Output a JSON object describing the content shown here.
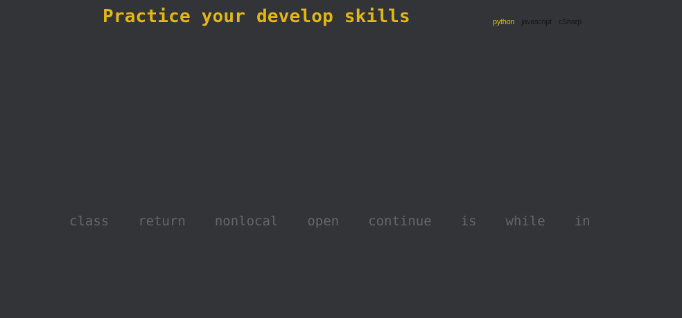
{
  "header": {
    "title": "Practice your develop skills"
  },
  "languages": [
    {
      "label": "python",
      "active": true
    },
    {
      "label": "javascript",
      "active": false
    },
    {
      "label": "cSharp",
      "active": false
    }
  ],
  "words": [
    "class",
    "return",
    "nonlocal",
    "open",
    "continue",
    "is",
    "while",
    "in"
  ],
  "colors": {
    "background": "#323437",
    "accent": "#e2b714",
    "word_untyped": "#646669",
    "inactive_link": "#141517"
  }
}
